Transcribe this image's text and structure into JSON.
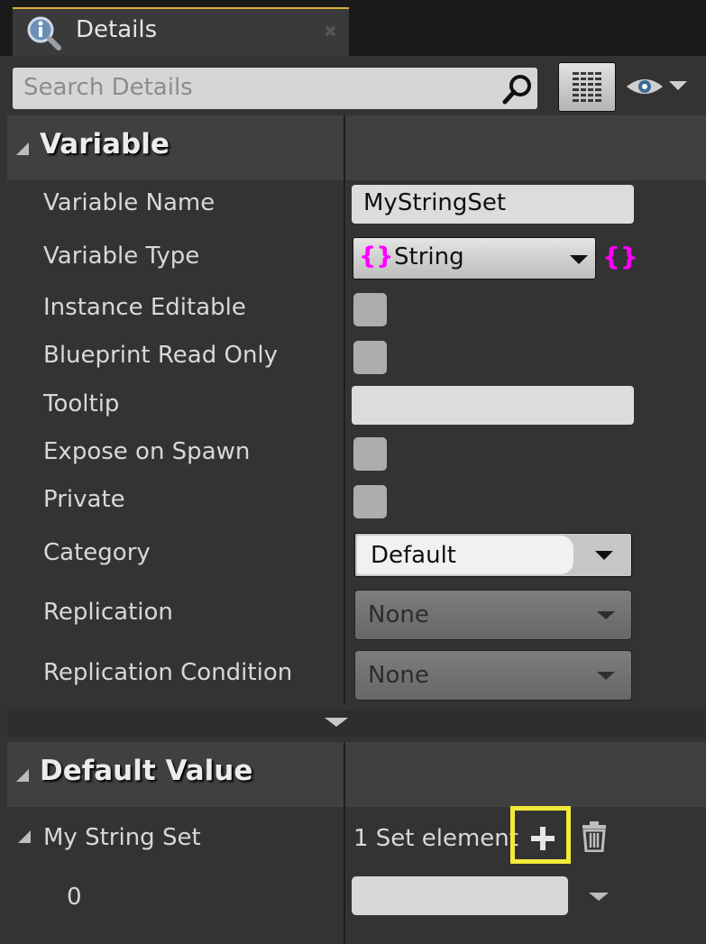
{
  "tab": {
    "title": "Details",
    "close_glyph": "✖"
  },
  "search": {
    "placeholder": "Search Details"
  },
  "sections": {
    "variable": {
      "title": "Variable"
    },
    "default_value": {
      "title": "Default Value"
    }
  },
  "variable": {
    "name": {
      "label": "Variable Name",
      "value": "MyStringSet"
    },
    "type": {
      "label": "Variable Type",
      "value": "String",
      "pin_glyph": "{}",
      "container_glyph": "{}"
    },
    "instance_editable": {
      "label": "Instance Editable",
      "checked": false
    },
    "blueprint_read_only": {
      "label": "Blueprint Read Only",
      "checked": false
    },
    "tooltip": {
      "label": "Tooltip",
      "value": ""
    },
    "expose_on_spawn": {
      "label": "Expose on Spawn",
      "checked": false
    },
    "private": {
      "label": "Private",
      "checked": false
    },
    "category": {
      "label": "Category",
      "value": "Default"
    },
    "replication": {
      "label": "Replication",
      "value": "None"
    },
    "replication_condition": {
      "label": "Replication Condition",
      "value": "None"
    }
  },
  "default_value": {
    "set_label": "My String Set",
    "element_count": "1 Set element",
    "elements": [
      {
        "index": "0",
        "value": ""
      }
    ]
  },
  "colors": {
    "string_pin": "#ff00ff",
    "highlight": "#f3ea3a",
    "tab_accent": "#d8b23a"
  },
  "icons": [
    "details-icon",
    "search-icon",
    "grid-view-icon",
    "eye-icon",
    "plus-icon",
    "trash-icon"
  ]
}
